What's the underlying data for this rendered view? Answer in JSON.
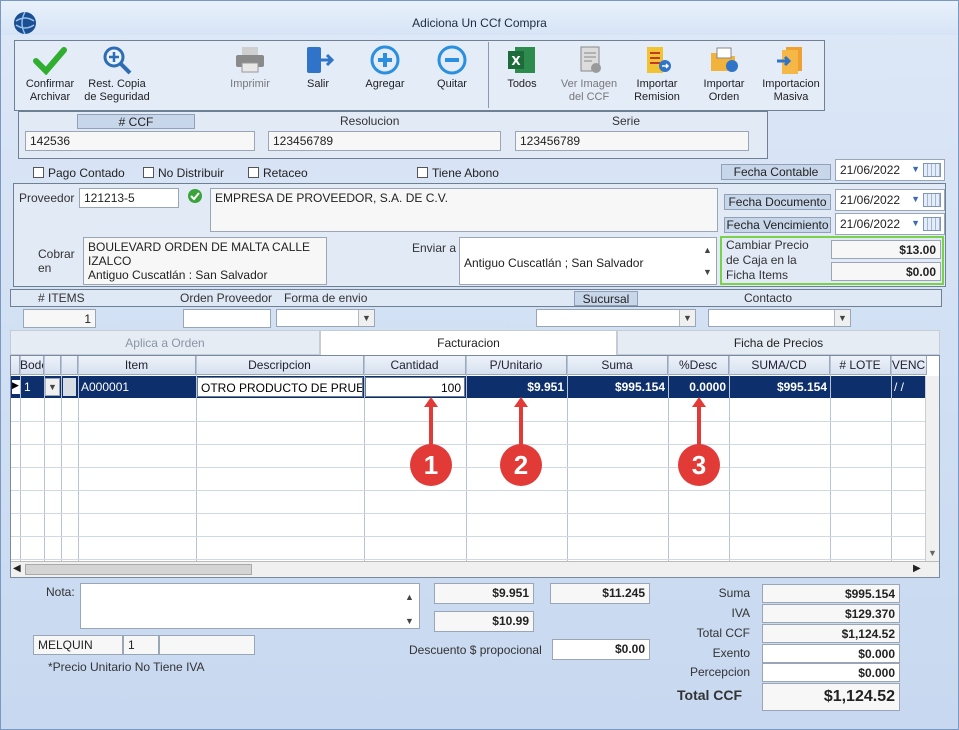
{
  "window": {
    "title": "Adiciona Un CCf Compra"
  },
  "toolbar": {
    "confirmar": "Confirmar\nArchivar",
    "restcopia": "Rest. Copia\nde Seguridad",
    "imprimir": "Imprimir",
    "salir": "Salir",
    "agregar": "Agregar",
    "quitar": "Quitar",
    "todos": "Todos",
    "ver_imagen": "Ver Imagen\ndel CCF",
    "importar_remision": "Importar\nRemision",
    "importar_orden": "Importar\nOrden",
    "importacion_masiva": "Importacion\nMasiva"
  },
  "header": {
    "ccf_label": "# CCF",
    "ccf_value": "142536",
    "resolucion_label": "Resolucion",
    "resolucion_value": "123456789",
    "serie_label": "Serie",
    "serie_value": "123456789"
  },
  "options": {
    "pago_contado": "Pago Contado",
    "no_distribuir": "No Distribuir",
    "retaceo": "Retaceo",
    "tiene_abono": "Tiene Abono",
    "fecha_contable_label": "Fecha Contable",
    "fecha_contable": "21/06/2022"
  },
  "proveedor": {
    "label": "Proveedor",
    "code": "121213-5",
    "name": "EMPRESA DE PROVEEDOR, S.A. DE C.V.",
    "fecha_doc_label": "Fecha Documento",
    "fecha_doc": "21/06/2022",
    "fecha_venc_label": "Fecha Vencimiento",
    "fecha_venc": "21/06/2022"
  },
  "cobrar": {
    "label": "Cobrar en",
    "line1": "BOULEVARD ORDEN DE MALTA CALLE",
    "line2": "IZALCO",
    "line3": "Antiguo Cuscatlán : San Salvador"
  },
  "enviar": {
    "label": "Enviar a",
    "value": "Antiguo Cuscatlán ; San Salvador"
  },
  "precio_caja": {
    "label": "Cambiar Precio de Caja en la Ficha Items",
    "value1": "$13.00",
    "value2": "$0.00"
  },
  "row2": {
    "items_label": "# ITEMS",
    "items_value": "1",
    "orden_label": "Orden Proveedor",
    "forma_label": "Forma de envio",
    "sucursal_label": "Sucursal",
    "contacto_label": "Contacto"
  },
  "tabs": [
    "Aplica a Orden",
    "Facturacion",
    "Ficha de Precios"
  ],
  "grid": {
    "headers": [
      "Bodega",
      "",
      "Item",
      "Descripcion",
      "Cantidad",
      "P/Unitario",
      "Suma",
      "%Desc",
      "SUMA/CD",
      "# LOTE",
      "VENC"
    ],
    "row": {
      "bodega": "1",
      "item": "A000001",
      "descripcion": "OTRO PRODUCTO DE PRUEBA",
      "cantidad": "100",
      "punitario": "$9.951",
      "suma": "$995.154",
      "desc": "0.0000",
      "sumacd": "$995.154",
      "lote": "",
      "venc": "/  /"
    }
  },
  "badges": [
    "1",
    "2",
    "3"
  ],
  "footer": {
    "nota_label": "Nota:",
    "price1": "$9.951",
    "price2": "$11.245",
    "price3": "$10.99",
    "descuento_label": "Descuento $ propocional",
    "descuento": "$0.00",
    "user": "MELQUIN",
    "user_num": "1",
    "note": "*Precio Unitario No Tiene IVA"
  },
  "totals": {
    "suma_label": "Suma",
    "suma": "$995.154",
    "iva_label": "IVA",
    "iva": "$129.370",
    "total_ccf_label": "Total CCF",
    "total_ccf": "$1,124.52",
    "exento_label": "Exento",
    "exento": "$0.000",
    "percepcion_label": "Percepcion",
    "percepcion": "$0.000",
    "grand_label": "Total CCF",
    "grand": "$1,124.52"
  },
  "colors": {
    "selected_row": "#0d2f6b",
    "badge": "#e23a36",
    "highlight_border": "#7ad14a"
  }
}
